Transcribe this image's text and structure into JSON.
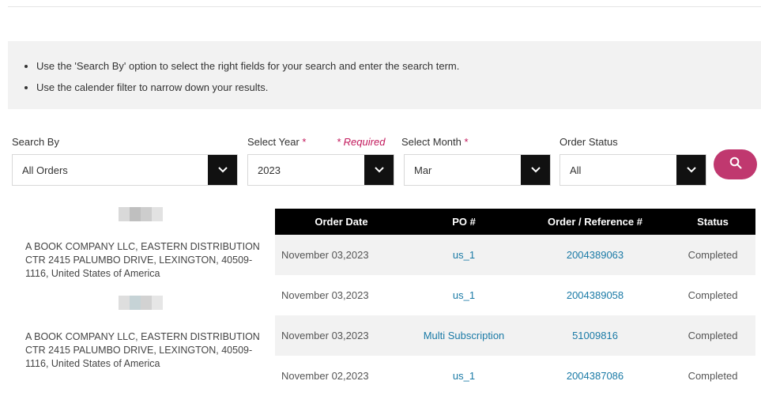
{
  "info": {
    "bullets": [
      "Use the 'Search By' option to select the right fields for your search and enter the search term.",
      "Use the calender filter to narrow down your results."
    ]
  },
  "filters": {
    "search_by": {
      "label": "Search By",
      "value": "All Orders"
    },
    "year": {
      "label": "Select Year",
      "star": "*",
      "value": "2023"
    },
    "required_note": "* Required",
    "month": {
      "label": "Select Month",
      "star": "*",
      "value": "Mar"
    },
    "status": {
      "label": "Order Status",
      "value": "All"
    }
  },
  "addresses": [
    "A BOOK COMPANY LLC, EASTERN DISTRIBUTION CTR 2415 PALUMBO DRIVE, LEXINGTON, 40509-1116, United States of America",
    "A BOOK COMPANY LLC, EASTERN DISTRIBUTION CTR 2415 PALUMBO DRIVE, LEXINGTON, 40509-1116, United States of America"
  ],
  "table": {
    "headers": [
      "Order Date",
      "PO #",
      "Order / Reference #",
      "Status"
    ],
    "rows": [
      {
        "date": "November 03,2023",
        "po": "us_1",
        "ref": "2004389063",
        "status": "Completed"
      },
      {
        "date": "November 03,2023",
        "po": "us_1",
        "ref": "2004389058",
        "status": "Completed"
      },
      {
        "date": "November 03,2023",
        "po": "Multi Subscription",
        "ref": "51009816",
        "status": "Completed"
      },
      {
        "date": "November 02,2023",
        "po": "us_1",
        "ref": "2004387086",
        "status": "Completed"
      }
    ]
  },
  "colors": {
    "accent": "#c0386f",
    "link": "#1a7aa6",
    "header_bg": "#000000",
    "info_bg": "#f2f2f2"
  }
}
